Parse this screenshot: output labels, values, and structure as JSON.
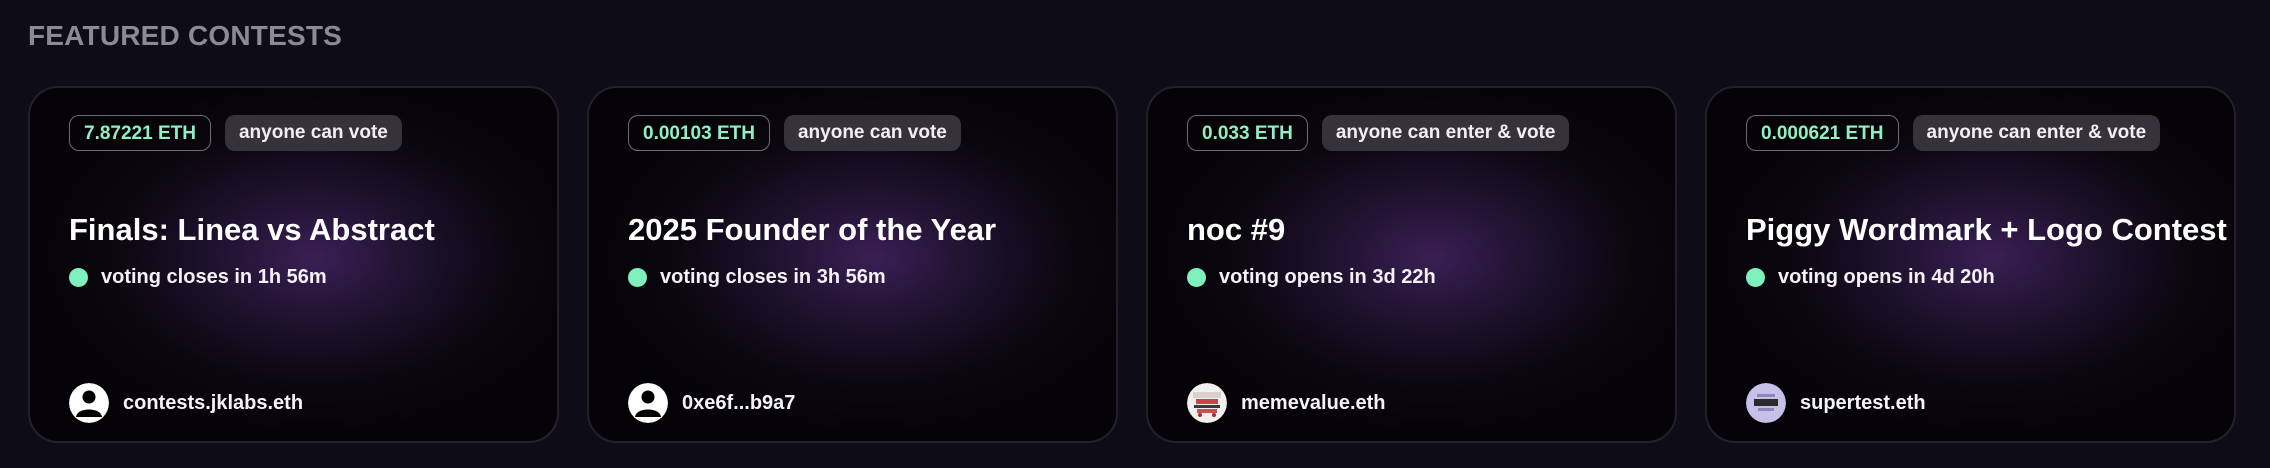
{
  "section": {
    "title": "FEATURED CONTESTS"
  },
  "contests": [
    {
      "prize": "7.87221 ETH",
      "access": "anyone can vote",
      "title": "Finals: Linea vs Abstract",
      "status": "voting closes in 1h 56m",
      "creator": "contests.jklabs.eth",
      "avatar_icon": "default-user-icon"
    },
    {
      "prize": "0.00103 ETH",
      "access": "anyone can vote",
      "title": "2025 Founder of the Year",
      "status": "voting closes in 3h 56m",
      "creator": "0xe6f...b9a7",
      "avatar_icon": "default-user-icon"
    },
    {
      "prize": "0.033 ETH",
      "access": "anyone can enter & vote",
      "title": "noc #9",
      "status": "voting opens in 3d 22h",
      "creator": "memevalue.eth",
      "avatar_icon": "meme-avatar-icon"
    },
    {
      "prize": "0.000621 ETH",
      "access": "anyone can enter & vote",
      "title": "Piggy Wordmark + Logo Contest",
      "status": "voting opens in 4d 20h",
      "creator": "supertest.eth",
      "avatar_icon": "lavender-avatar-icon"
    }
  ],
  "colors": {
    "prize_text": "#8ff0c2",
    "status_dot": "#7ef0bc",
    "section_title": "#8c8a93",
    "card_glow": "#3a1f55"
  }
}
